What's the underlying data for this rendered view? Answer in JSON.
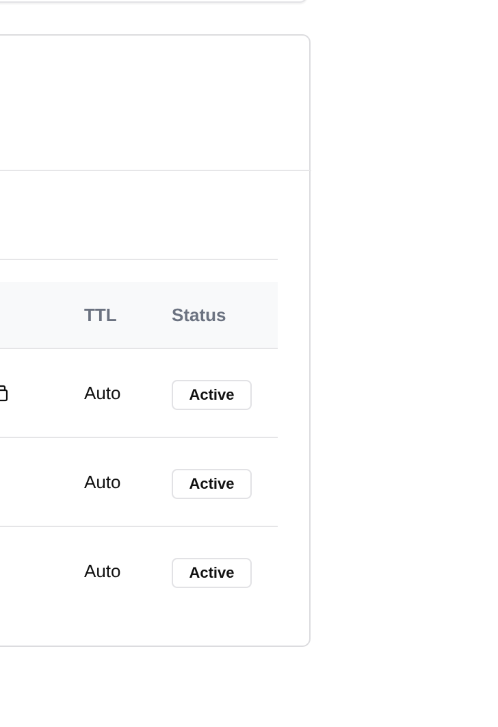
{
  "table": {
    "headers": {
      "ttl": "TTL",
      "status": "Status"
    },
    "rows": [
      {
        "ttl": "Auto",
        "status": "Active",
        "icon": "copy-icon"
      },
      {
        "ttl": "Auto",
        "status": "Active"
      },
      {
        "ttl": "Auto",
        "status": "Active"
      }
    ]
  },
  "colors": {
    "header_text": "#6b7280",
    "header_bg": "#f8f9fa",
    "border": "#e5e5e7",
    "text": "#111111"
  }
}
